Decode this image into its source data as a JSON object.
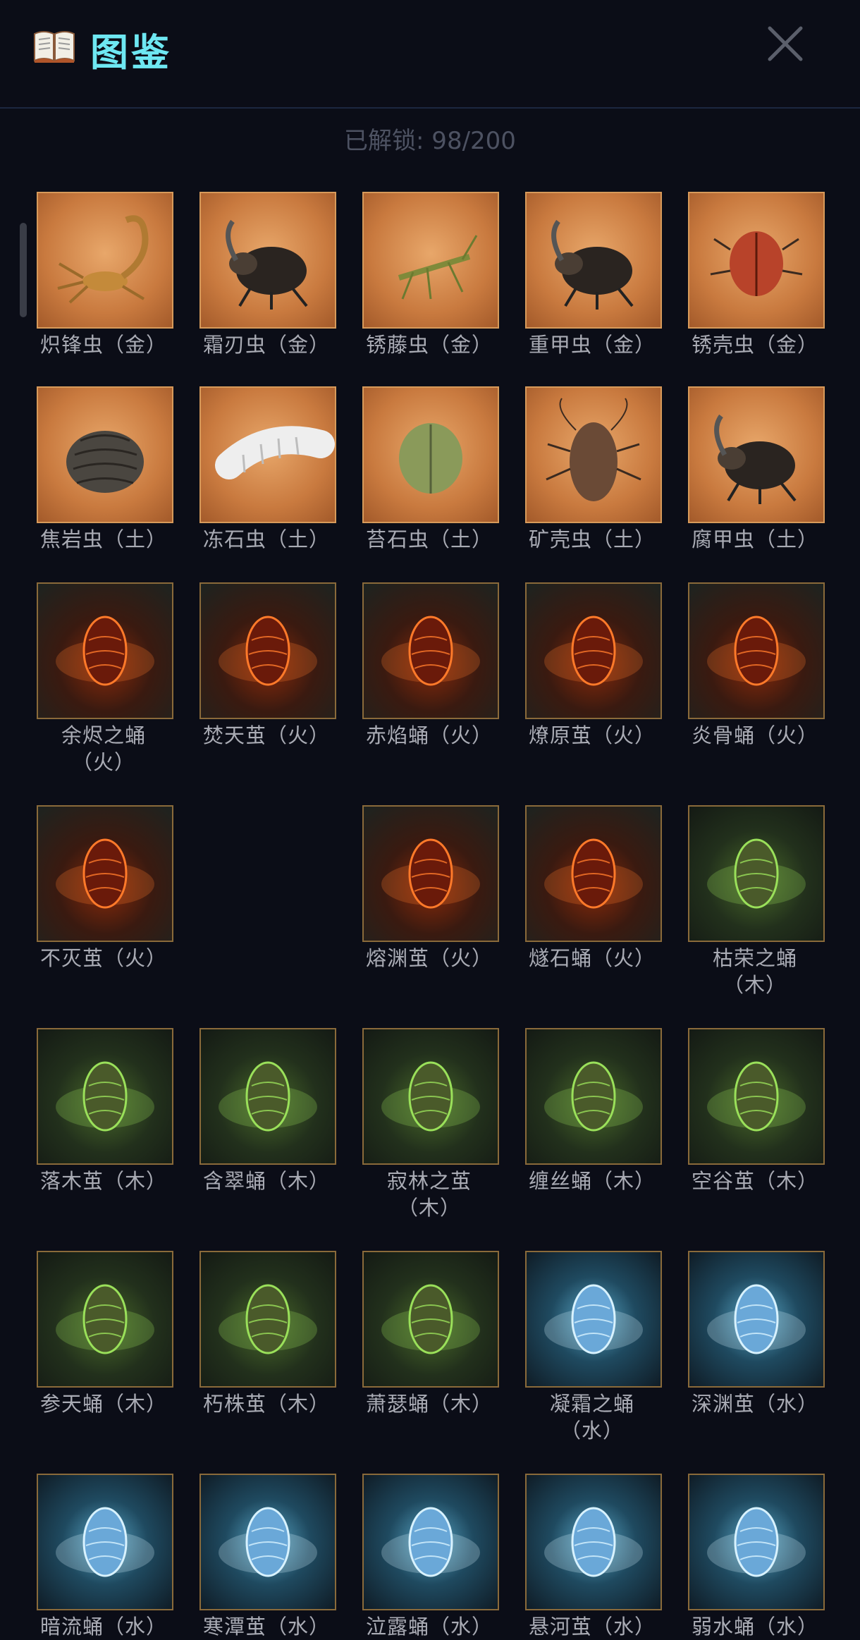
{
  "header": {
    "title": "图鉴"
  },
  "unlock_text": "已解锁: 98/200",
  "colors": {
    "accent": "#6ee7f2",
    "background": "#0b0d17"
  },
  "items": [
    {
      "name": "炽锋虫（金）",
      "icon": "scorpion",
      "theme": "parch"
    },
    {
      "name": "霜刃虫（金）",
      "icon": "rhino-beetle",
      "theme": "parch"
    },
    {
      "name": "锈藤虫（金）",
      "icon": "mantis",
      "theme": "parch"
    },
    {
      "name": "重甲虫（金）",
      "icon": "horned-beetle",
      "theme": "parch"
    },
    {
      "name": "锈壳虫（金）",
      "icon": "shield-bug",
      "theme": "parch"
    },
    {
      "name": "焦岩虫（土）",
      "icon": "pill-bug",
      "theme": "parch"
    },
    {
      "name": "冻石虫（土）",
      "icon": "white-larva",
      "theme": "parch"
    },
    {
      "name": "苔石虫（土）",
      "icon": "moss-beetle",
      "theme": "parch"
    },
    {
      "name": "矿壳虫（土）",
      "icon": "roach",
      "theme": "parch"
    },
    {
      "name": "腐甲虫（土）",
      "icon": "dung-beetle",
      "theme": "parch"
    },
    {
      "name": "余烬之蛹（火）",
      "icon": "ember-pupa",
      "theme": "fire"
    },
    {
      "name": "焚天茧（火）",
      "icon": "fire-cocoon",
      "theme": "fire"
    },
    {
      "name": "赤焰蛹（火）",
      "icon": "red-flame-pupa",
      "theme": "fire"
    },
    {
      "name": "燎原茧（火）",
      "icon": "burning-cocoon",
      "theme": "fire"
    },
    {
      "name": "炎骨蛹（火）",
      "icon": "lava-egg",
      "theme": "fire"
    },
    {
      "name": "不灭茧（火）",
      "icon": "cave-ember",
      "theme": "fire"
    },
    {
      "name": "熔渊茧（火）",
      "icon": "magma-cocoon",
      "theme": "fire"
    },
    {
      "name": "燧石蛹（火）",
      "icon": "flint-pupa",
      "theme": "fire"
    },
    {
      "name": "枯荣之蛹（木）",
      "icon": "sprout-egg",
      "theme": "wood"
    },
    {
      "name": "落木茧（木）",
      "icon": "leaf-cocoon",
      "theme": "wood"
    },
    {
      "name": "含翠蛹（木）",
      "icon": "jade-pupa",
      "theme": "wood"
    },
    {
      "name": "寂林之茧（木）",
      "icon": "hanging-cocoon",
      "theme": "wood"
    },
    {
      "name": "缠丝蛹（木）",
      "icon": "vine-pupa",
      "theme": "wood"
    },
    {
      "name": "空谷茧（木）",
      "icon": "glow-cocoon",
      "theme": "wood"
    },
    {
      "name": "参天蛹（木）",
      "icon": "root-pupa",
      "theme": "wood"
    },
    {
      "name": "朽株茧（木）",
      "icon": "stump-cocoon",
      "theme": "wood"
    },
    {
      "name": "萧瑟蛹（木）",
      "icon": "grate-pupa",
      "theme": "wood"
    },
    {
      "name": "凝霜之蛹（水）",
      "icon": "frost-pupa",
      "theme": "water"
    },
    {
      "name": "深渊茧（水）",
      "icon": "abyss-cocoon",
      "theme": "water"
    },
    {
      "name": "暗流蛹（水）",
      "icon": "blue-pupa",
      "theme": "water"
    },
    {
      "name": "寒潭茧（水）",
      "icon": "ice-cocoon",
      "theme": "water"
    },
    {
      "name": "泣露蛹（水）",
      "icon": "dew-pupa",
      "theme": "water"
    },
    {
      "name": "悬河茧（水）",
      "icon": "waterfall-cocoon",
      "theme": "water"
    },
    {
      "name": "弱水蛹（水）",
      "icon": "pale-pupa",
      "theme": "water"
    }
  ]
}
